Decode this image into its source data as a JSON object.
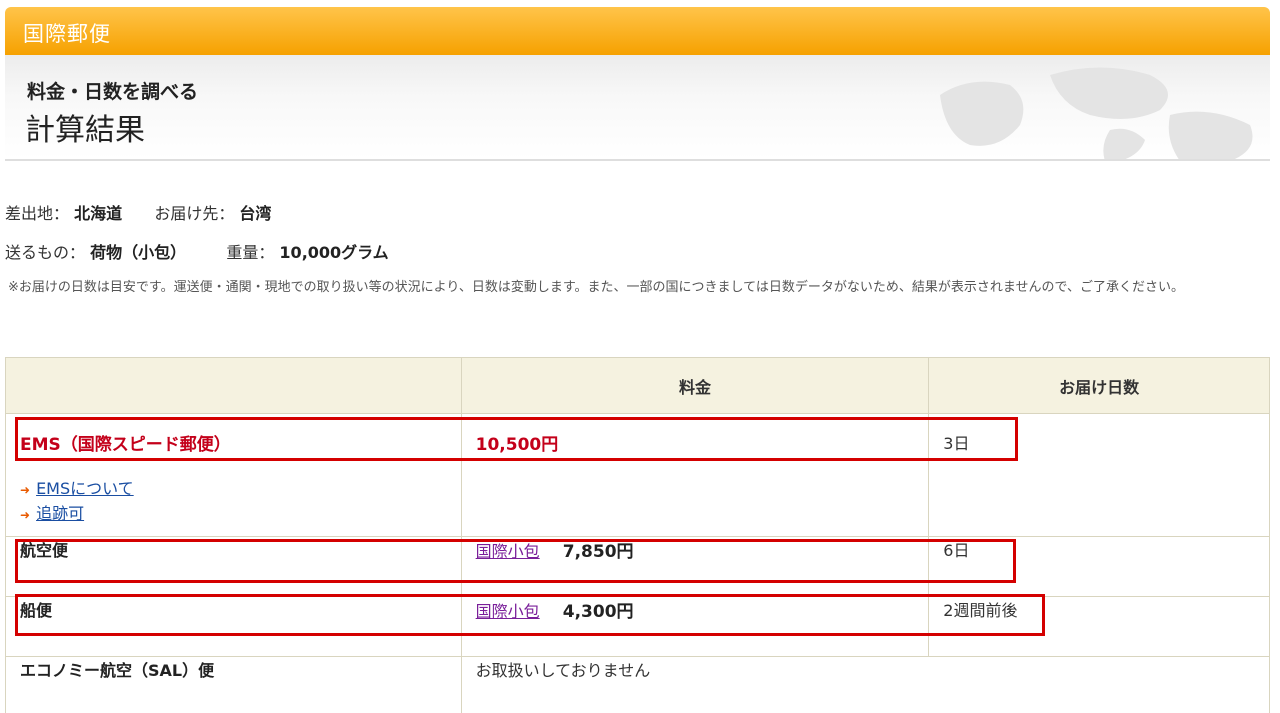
{
  "header": {
    "category": "国際郵便",
    "subtitle": "料金・日数を調べる",
    "title": "計算結果"
  },
  "summary": {
    "origin_label": "差出地：",
    "origin_value": "北海道",
    "dest_label": "お届け先：",
    "dest_value": "台湾",
    "item_label": "送るもの：",
    "item_value": "荷物（小包）",
    "weight_label": "重量：",
    "weight_value": "10,000グラム"
  },
  "note": "※お届けの日数は目安です。運送便・通関・現地での取り扱い等の状況により、日数は変動します。また、一部の国につきましては日数データがないため、結果が表示されませんので、ご了承ください。",
  "table": {
    "headers": [
      "",
      "料金",
      "お届け日数"
    ],
    "ems": {
      "name": "EMS（国際スピード郵便）",
      "price": "10,500円",
      "days": "3日",
      "link1": "EMSについて",
      "link2": "追跡可"
    },
    "air": {
      "name": "航空便",
      "service": "国際小包",
      "price": "7,850円",
      "days": "6日"
    },
    "sea": {
      "name": "船便",
      "service": "国際小包",
      "price": "4,300円",
      "days": "2週間前後"
    },
    "sal": {
      "name": "エコノミー航空（SAL）便",
      "status": "お取扱いしておりません"
    }
  },
  "colors": {
    "accent": "#f6a100",
    "highlight": "#d40000",
    "ems_text": "#c4001a"
  }
}
